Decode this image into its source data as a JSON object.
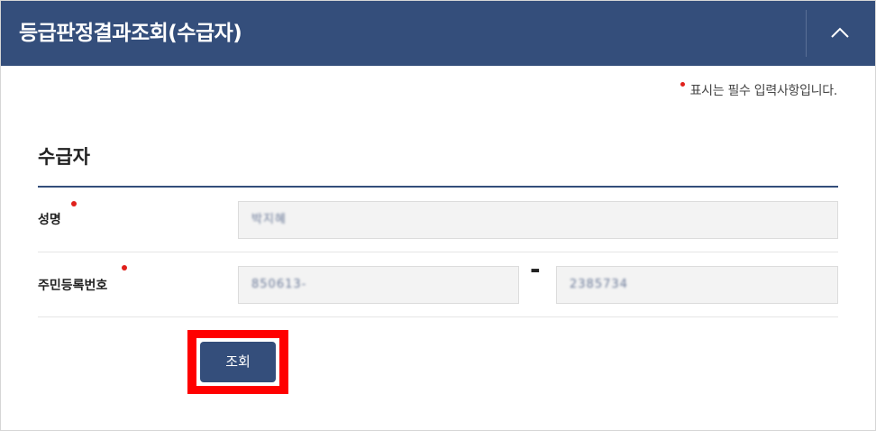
{
  "header": {
    "title": "등급판정결과조회(수급자)",
    "collapse_icon": "chevron-up-icon"
  },
  "required_note": "표시는 필수 입력사항입니다.",
  "section": {
    "title": "수급자"
  },
  "fields": {
    "name": {
      "label": "성명",
      "value": "박지혜"
    },
    "resident_number": {
      "label": "주민등록번호",
      "front_value": "850613-",
      "separator": "-",
      "back_value": "2385734"
    }
  },
  "actions": {
    "search_label": "조회"
  },
  "colors": {
    "header_bg": "#344e7b",
    "required_dot": "#e0201b",
    "highlight": "#ff0000"
  }
}
